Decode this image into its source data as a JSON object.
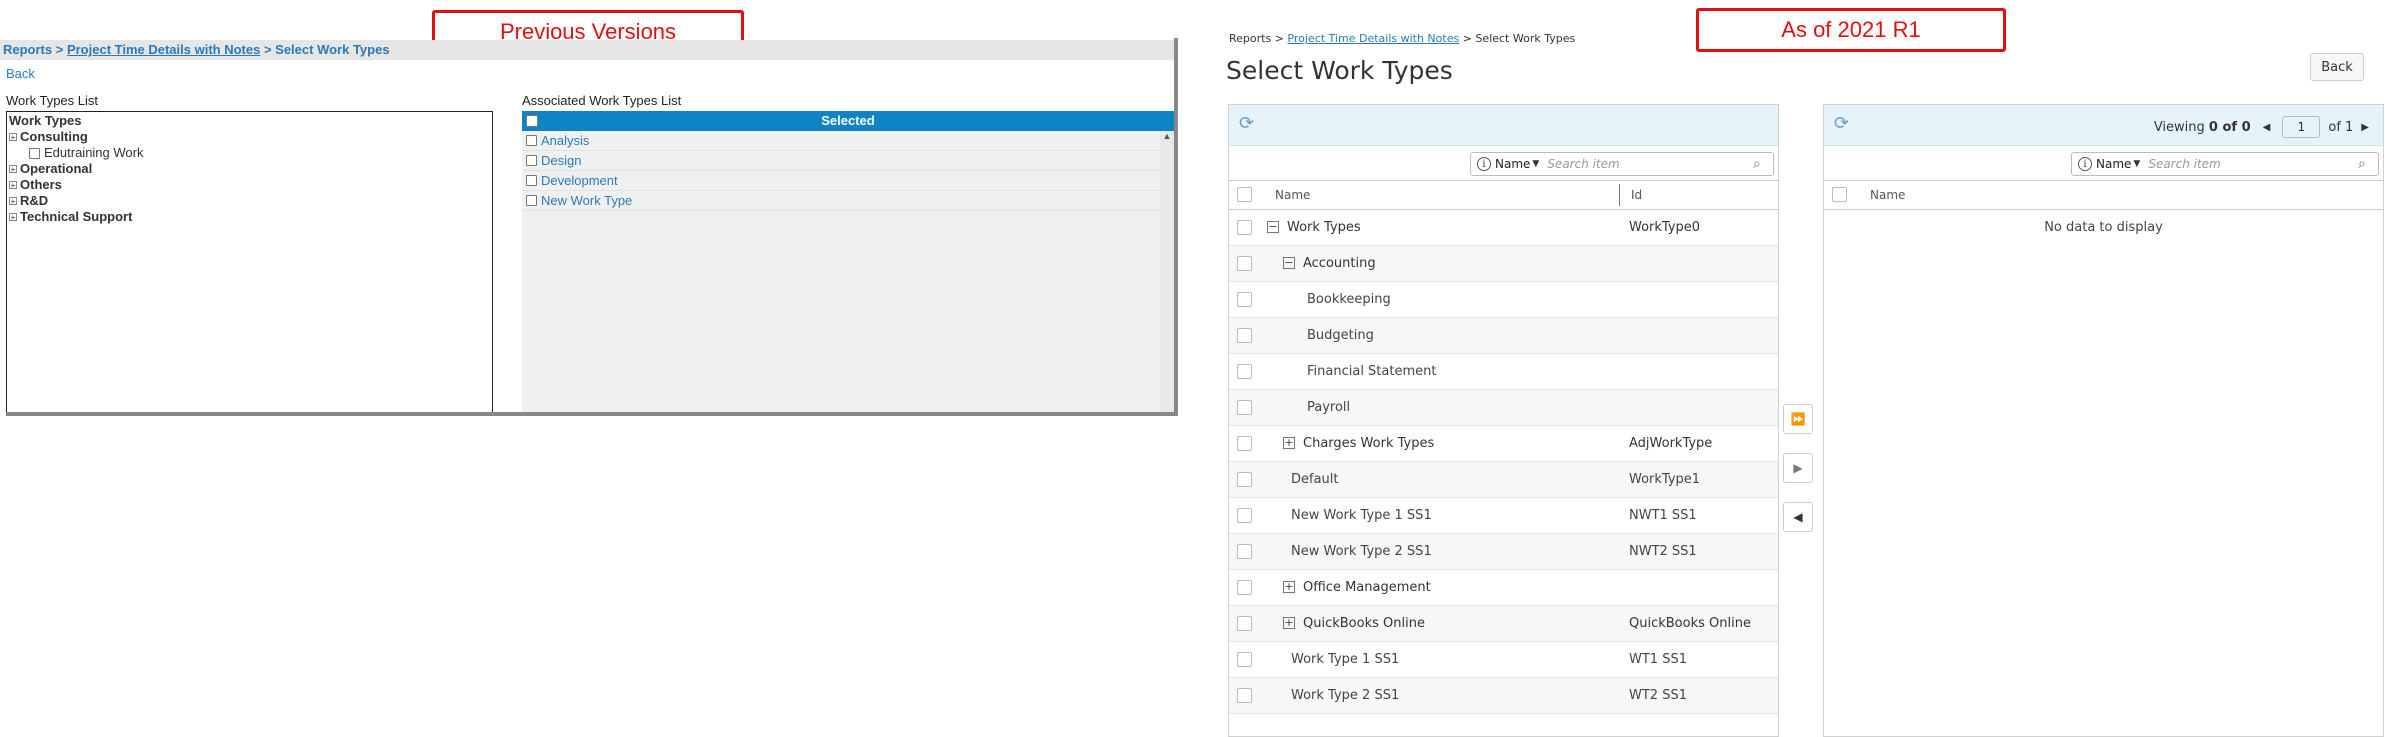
{
  "callouts": {
    "previous": "Previous Versions",
    "current": "As of 2021 R1"
  },
  "old_ui": {
    "breadcrumb": {
      "root": "Reports",
      "sep1": " > ",
      "link": "Project Time Details with Notes",
      "sep2": " > ",
      "current": "Select Work Types"
    },
    "back": "Back",
    "work_types_list_label": "Work Types List",
    "associated_list_label": "Associated Work Types List",
    "tree": {
      "root": "Work Types",
      "items": [
        {
          "label": "Consulting",
          "child": "Edutraining Work"
        },
        {
          "label": "Operational"
        },
        {
          "label": "Others"
        },
        {
          "label": "R&D"
        },
        {
          "label": "Technical Support"
        }
      ]
    },
    "associated": {
      "header": "Selected",
      "items": [
        "Analysis",
        "Design",
        "Development",
        "New Work Type"
      ]
    }
  },
  "new_ui": {
    "breadcrumb": {
      "root": "Reports",
      "sep1": " > ",
      "link": "Project Time Details with Notes",
      "sep2": " > ",
      "current": "Select Work Types"
    },
    "title": "Select Work Types",
    "back": "Back",
    "left_panel": {
      "search_field": "Name",
      "search_placeholder": "Search item",
      "columns": {
        "name": "Name",
        "id": "Id"
      },
      "rows": [
        {
          "name": "Work Types",
          "id": "WorkType0"
        },
        {
          "name": "Accounting",
          "id": ""
        },
        {
          "name": "Bookkeeping",
          "id": ""
        },
        {
          "name": "Budgeting",
          "id": ""
        },
        {
          "name": "Financial Statement",
          "id": ""
        },
        {
          "name": "Payroll",
          "id": ""
        },
        {
          "name": "Charges Work Types",
          "id": "AdjWorkType"
        },
        {
          "name": "Default",
          "id": "WorkType1"
        },
        {
          "name": "New Work Type 1 SS1",
          "id": "NWT1 SS1"
        },
        {
          "name": "New Work Type 2 SS1",
          "id": "NWT2 SS1"
        },
        {
          "name": "Office Management",
          "id": ""
        },
        {
          "name": "QuickBooks Online",
          "id": "QuickBooks Online"
        },
        {
          "name": "Work Type 1 SS1",
          "id": "WT1 SS1"
        },
        {
          "name": "Work Type 2 SS1",
          "id": "WT2 SS1"
        }
      ]
    },
    "right_panel": {
      "viewing_label": "Viewing",
      "viewing_range": "0 of 0",
      "page_value": "1",
      "of_pages": "of 1",
      "search_field": "Name",
      "search_placeholder": "Search item",
      "columns": {
        "name": "Name"
      },
      "empty_text": "No data to display"
    },
    "transfer_buttons": {
      "move_all": "⏩",
      "move_one": "▶",
      "remove_one": "◀"
    },
    "expander_symbols": {
      "expanded": "−",
      "collapsed": "+"
    }
  }
}
